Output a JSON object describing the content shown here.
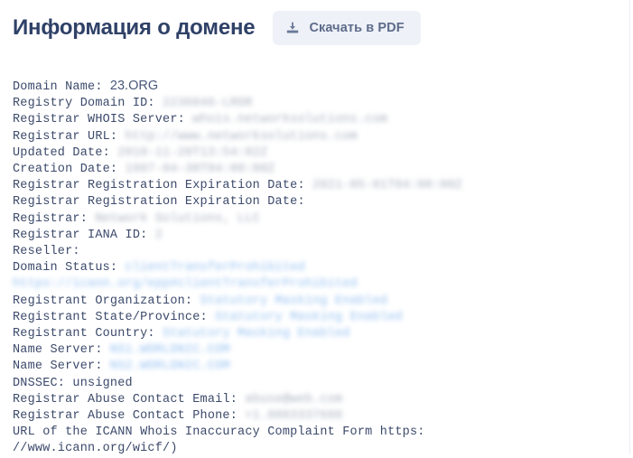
{
  "header": {
    "title": "Информация о домене",
    "download_button": {
      "label": "Скачать в PDF",
      "icon": "download-icon"
    }
  },
  "colors": {
    "title": "#2f4167",
    "button_bg": "#eef1f7",
    "button_text": "#5d6b8a",
    "body_text": "#3c4a6b",
    "link": "#8dbdf0",
    "masked": "#9aa3b5",
    "page_bg": "#ffffff"
  },
  "whois": {
    "lines": [
      {
        "label": "Domain Name: ",
        "value": "23.ORG",
        "style": "plain"
      },
      {
        "label": "Registry Domain ID: ",
        "value": "2236046-LROR",
        "style": "masked"
      },
      {
        "label": "Registrar WHOIS Server: ",
        "value": "whois.networksolutions.com",
        "style": "masked"
      },
      {
        "label": "Registrar URL: ",
        "value": "http://www.networksolutions.com",
        "style": "masked"
      },
      {
        "label": "Updated Date: ",
        "value": "2018-11-20T13:54:02Z",
        "style": "masked"
      },
      {
        "label": "Creation Date: ",
        "value": "1997-04-30T04:00:00Z",
        "style": "masked"
      },
      {
        "label": "Registrar Registration Expiration Date: ",
        "value": "2021-05-01T04:00:00Z",
        "style": "masked"
      },
      {
        "label": "Registrar Registration Expiration Date: ",
        "value": "",
        "style": "masked"
      },
      {
        "label": "Registrar: ",
        "value": "Network Solutions, LLC",
        "style": "masked"
      },
      {
        "label": "Registrar IANA ID: ",
        "value": "2",
        "style": "masked"
      },
      {
        "label": "Reseller: ",
        "value": "",
        "style": "masked"
      },
      {
        "label": "Domain Status: ",
        "value": "clientTransferProhibited https://icann.org/epp#clientTransferProhibited",
        "style": "link"
      },
      {
        "label": "Registrant Organization: ",
        "value": "Statutory Masking Enabled",
        "style": "link"
      },
      {
        "label": "Registrant State/Province: ",
        "value": "Statutory Masking Enabled",
        "style": "link"
      },
      {
        "label": "Registrant Country: ",
        "value": "Statutory Masking Enabled",
        "style": "link"
      },
      {
        "label": "Name Server: ",
        "value": "NS1.WORLDNIC.COM",
        "style": "link"
      },
      {
        "label": "Name Server: ",
        "value": "NS2.WORLDNIC.COM",
        "style": "link"
      },
      {
        "label": "DNSSEC: unsigned",
        "value": "",
        "style": "clear"
      },
      {
        "label": "Registrar Abuse Contact Email: ",
        "value": "abuse@web.com",
        "style": "masked"
      },
      {
        "label": "Registrar Abuse Contact Phone: ",
        "value": "+1.8003337680",
        "style": "masked"
      },
      {
        "label": "URL of the ICANN Whois Inaccuracy Complaint Form https:",
        "value": "",
        "style": "clear"
      },
      {
        "label": "//www.icann.org/wicf/)",
        "value": "",
        "style": "clear"
      }
    ]
  }
}
